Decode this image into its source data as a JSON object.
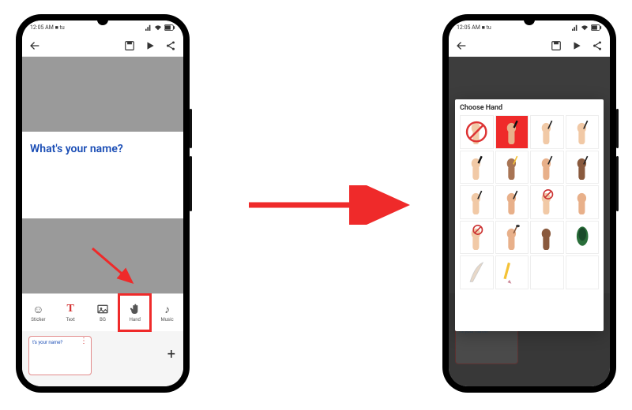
{
  "status": {
    "time": "12:05 AM",
    "extra": "■ tu"
  },
  "canvas": {
    "text": "What's your name?"
  },
  "toolbar": [
    {
      "name": "sticker",
      "label": "Sticker"
    },
    {
      "name": "text",
      "label": "Text"
    },
    {
      "name": "bg",
      "label": "BG"
    },
    {
      "name": "hand",
      "label": "Hand"
    },
    {
      "name": "music",
      "label": "Music"
    }
  ],
  "mini_card": {
    "text": "t's your name?"
  },
  "modal": {
    "title": "Choose Hand",
    "hands": [
      {
        "tone": "#f1c9a6",
        "tool": "none",
        "bg": "#fff"
      },
      {
        "tone": "#e8b08a",
        "tool": "marker",
        "bg": "#ef2a2a"
      },
      {
        "tone": "#f1c9a6",
        "tool": "pen",
        "bg": "#fff"
      },
      {
        "tone": "#f1c9a6",
        "tool": "pen",
        "bg": "#fff"
      },
      {
        "tone": "#f1c9a6",
        "tool": "marker",
        "bg": "#fff"
      },
      {
        "tone": "#a87454",
        "tool": "pencil",
        "bg": "#fff"
      },
      {
        "tone": "#e8b08a",
        "tool": "pen",
        "bg": "#fff"
      },
      {
        "tone": "#8a5a3e",
        "tool": "pen",
        "bg": "#fff"
      },
      {
        "tone": "#f1c9a6",
        "tool": "pen",
        "bg": "#fff"
      },
      {
        "tone": "#e8b08a",
        "tool": "pen",
        "bg": "#fff"
      },
      {
        "tone": "#f1c9a6",
        "tool": "none",
        "bg": "#fff"
      },
      {
        "tone": "#e8b08a",
        "tool": "none",
        "bg": "#fff"
      },
      {
        "tone": "#f1c9a6",
        "tool": "none",
        "bg": "#fff"
      },
      {
        "tone": "#e8b08a",
        "tool": "brush",
        "bg": "#fff"
      },
      {
        "tone": "#8a5a3e",
        "tool": "none",
        "bg": "#fff"
      },
      {
        "tone": "#2a6e3a",
        "tool": "feather",
        "bg": "#fff"
      },
      {
        "tone": "#fff",
        "tool": "quill",
        "bg": "#fff"
      },
      {
        "tone": "#fff",
        "tool": "pencil-only",
        "bg": "#fff"
      },
      {
        "tone": "#fff",
        "tool": "blank",
        "bg": "#fff"
      },
      {
        "tone": "#fff",
        "tool": "blank",
        "bg": "#fff"
      }
    ]
  }
}
